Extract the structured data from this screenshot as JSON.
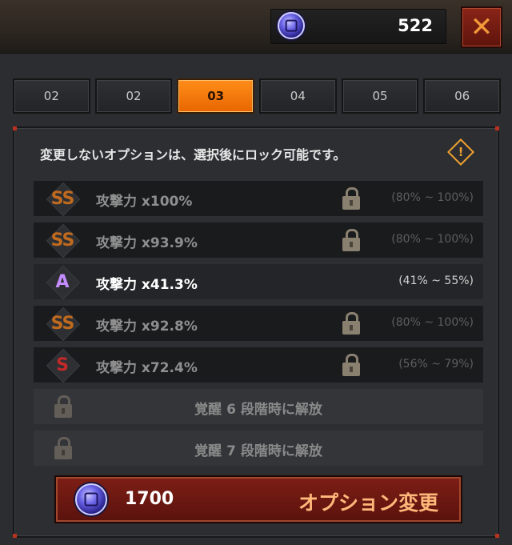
{
  "header": {
    "currency_icon": "purple-gem-icon",
    "currency_value": "522",
    "close_label": "✕"
  },
  "tabs": [
    {
      "label": "02",
      "active": false
    },
    {
      "label": "02",
      "active": false
    },
    {
      "label": "03",
      "active": true
    },
    {
      "label": "04",
      "active": false
    },
    {
      "label": "05",
      "active": false
    },
    {
      "label": "06",
      "active": false
    }
  ],
  "panel": {
    "notice": "変更しないオプションは、選択後にロック可能です。",
    "options": [
      {
        "grade": "SS",
        "stat": "攻撃力 x100%",
        "range": "(80% ~ 100%)",
        "locked": true
      },
      {
        "grade": "SS",
        "stat": "攻撃力 x93.9%",
        "range": "(80% ~ 100%)",
        "locked": true
      },
      {
        "grade": "A",
        "stat": "攻撃力 x41.3%",
        "range": "(41% ~ 55%)",
        "locked": false
      },
      {
        "grade": "SS",
        "stat": "攻撃力 x92.8%",
        "range": "(80% ~ 100%)",
        "locked": true
      },
      {
        "grade": "S",
        "stat": "攻撃力 x72.4%",
        "range": "(56% ~ 79%)",
        "locked": true
      }
    ],
    "locked_slots": [
      {
        "text": "覚醒 6 段階時に解放"
      },
      {
        "text": "覚醒 7 段階時に解放"
      }
    ]
  },
  "action": {
    "cost": "1700",
    "label": "オプション変更"
  },
  "colors": {
    "tab_active": "#ff8d1a",
    "button": "#7d1e16",
    "grade_ss": "#c06a1e",
    "grade_a": "#c48cff",
    "grade_s": "#c22a2a"
  }
}
